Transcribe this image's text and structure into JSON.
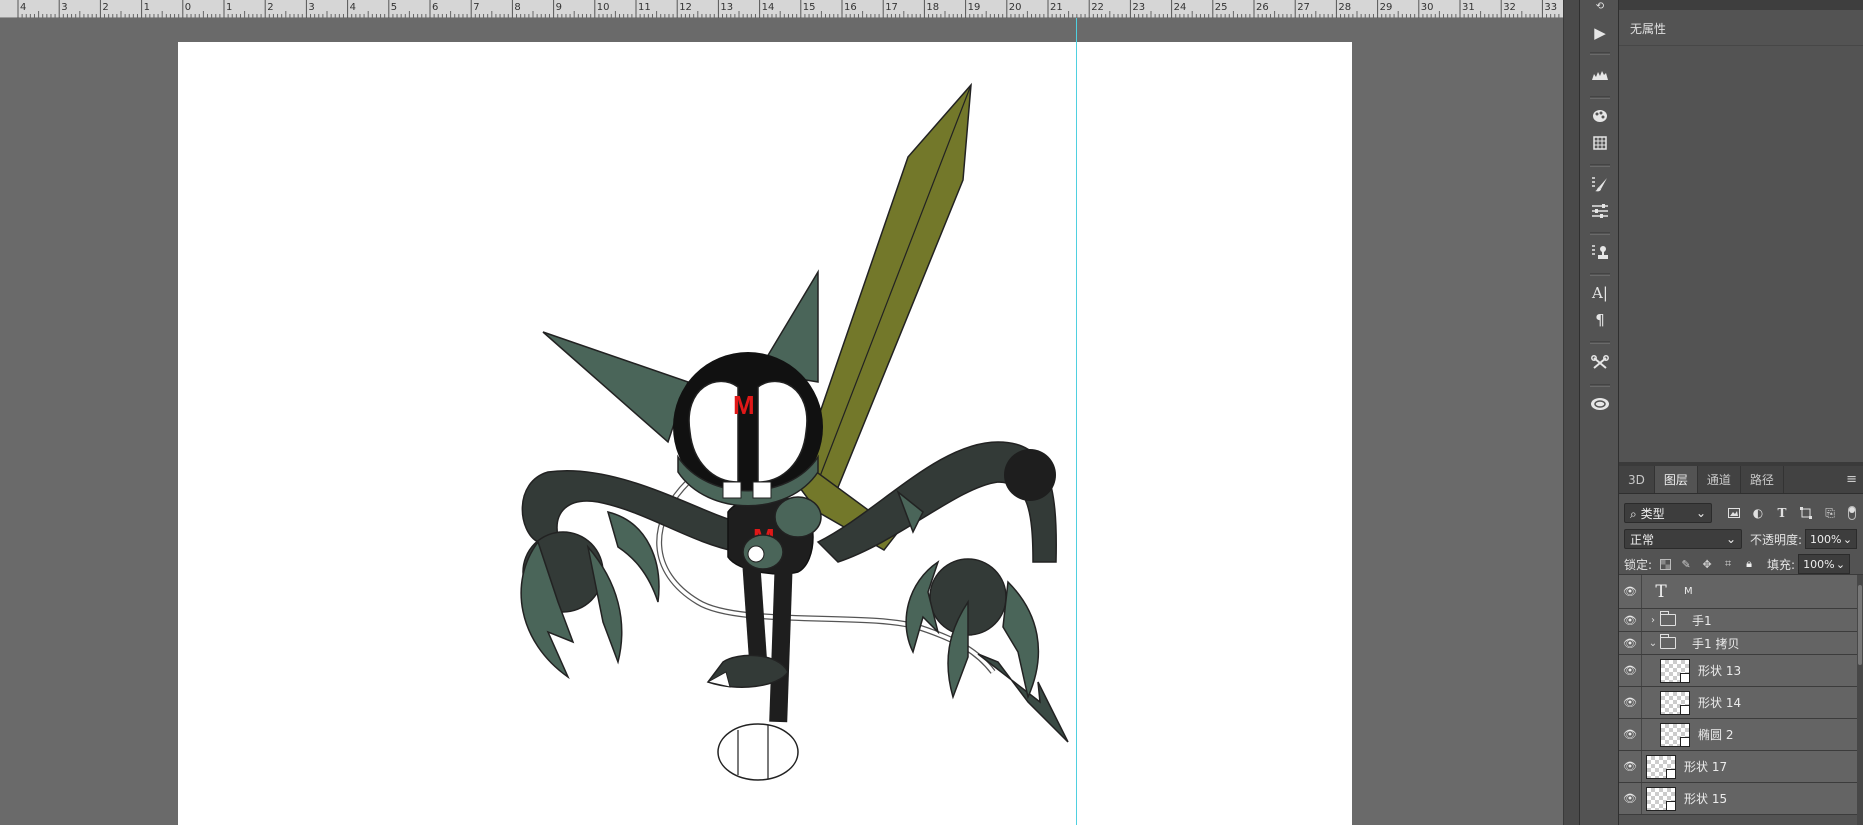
{
  "ruler": {
    "labels": [
      "4",
      "3",
      "2",
      "1",
      "0",
      "1",
      "2",
      "3",
      "4",
      "5",
      "6",
      "7",
      "8",
      "9",
      "10",
      "11",
      "12",
      "13",
      "14",
      "15",
      "16",
      "17",
      "18",
      "19",
      "20",
      "21",
      "22",
      "23",
      "24",
      "25",
      "26",
      "27",
      "28",
      "29",
      "30",
      "31",
      "32",
      "33"
    ]
  },
  "canvas": {
    "character_letter": "M",
    "chest_letter": "M"
  },
  "properties": {
    "no_properties": "无属性"
  },
  "layers": {
    "tabs": [
      {
        "label": "3D"
      },
      {
        "label": "图层"
      },
      {
        "label": "通道"
      },
      {
        "label": "路径"
      }
    ],
    "active_tab": "图层",
    "filter_kind": "类型",
    "blend_mode": "正常",
    "opacity_label": "不透明度:",
    "opacity_value": "100%",
    "lock_label": "锁定:",
    "fill_label": "填充:",
    "fill_value": "100%",
    "items": [
      {
        "name": "M",
        "kind": "text"
      },
      {
        "name": "手1",
        "kind": "group",
        "expanded": false
      },
      {
        "name": "手1 拷贝",
        "kind": "group",
        "expanded": true
      },
      {
        "name": "形状 13",
        "kind": "shape",
        "indent": true
      },
      {
        "name": "形状 14",
        "kind": "shape",
        "indent": true
      },
      {
        "name": "椭圆 2",
        "kind": "shape",
        "indent": true
      },
      {
        "name": "形状 17",
        "kind": "shape",
        "indent": false
      },
      {
        "name": "形状 15",
        "kind": "shape",
        "indent": false
      }
    ]
  },
  "icons": {
    "tools": [
      "play-icon",
      "histogram-icon",
      "color-palette-icon",
      "grid-icon",
      "brush-presets-icon",
      "adjustments-icon",
      "clone-source-icon",
      "character-icon",
      "paragraph-icon",
      "tool-presets-icon",
      "creative-cloud-icon"
    ]
  },
  "colors": {
    "body_green": "#4a6559",
    "sword": "#73782a",
    "dark": "#333a37",
    "accent_red": "#e01818",
    "guide": "#4fd0e0"
  }
}
